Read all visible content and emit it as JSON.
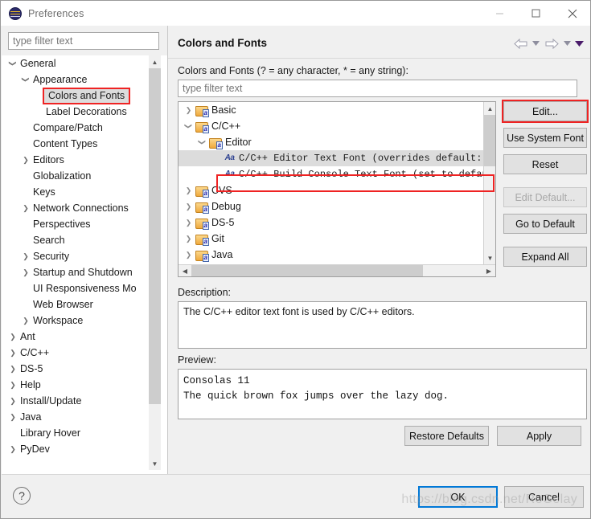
{
  "window": {
    "title": "Preferences",
    "icon": "eclipse-icon",
    "minimize_label": "—",
    "maximize_label": "□",
    "close_label": "✕"
  },
  "sidebar": {
    "filter_placeholder": "type filter text",
    "filter_value": "",
    "items": [
      {
        "label": "General",
        "depth": 0,
        "arrow": "expanded",
        "selected": false
      },
      {
        "label": "Appearance",
        "depth": 1,
        "arrow": "expanded",
        "selected": false
      },
      {
        "label": "Colors and Fonts",
        "depth": 2,
        "arrow": "none",
        "selected": true
      },
      {
        "label": "Label Decorations",
        "depth": 2,
        "arrow": "none",
        "selected": false
      },
      {
        "label": "Compare/Patch",
        "depth": 1,
        "arrow": "none",
        "selected": false
      },
      {
        "label": "Content Types",
        "depth": 1,
        "arrow": "none",
        "selected": false
      },
      {
        "label": "Editors",
        "depth": 1,
        "arrow": "collapsed",
        "selected": false
      },
      {
        "label": "Globalization",
        "depth": 1,
        "arrow": "none",
        "selected": false
      },
      {
        "label": "Keys",
        "depth": 1,
        "arrow": "none",
        "selected": false
      },
      {
        "label": "Network Connections",
        "depth": 1,
        "arrow": "collapsed",
        "selected": false
      },
      {
        "label": "Perspectives",
        "depth": 1,
        "arrow": "none",
        "selected": false
      },
      {
        "label": "Search",
        "depth": 1,
        "arrow": "none",
        "selected": false
      },
      {
        "label": "Security",
        "depth": 1,
        "arrow": "collapsed",
        "selected": false
      },
      {
        "label": "Startup and Shutdown",
        "depth": 1,
        "arrow": "collapsed",
        "selected": false
      },
      {
        "label": "UI Responsiveness Mo",
        "depth": 1,
        "arrow": "none",
        "selected": false
      },
      {
        "label": "Web Browser",
        "depth": 1,
        "arrow": "none",
        "selected": false
      },
      {
        "label": "Workspace",
        "depth": 1,
        "arrow": "collapsed",
        "selected": false
      },
      {
        "label": "Ant",
        "depth": 0,
        "arrow": "collapsed",
        "selected": false
      },
      {
        "label": "C/C++",
        "depth": 0,
        "arrow": "collapsed",
        "selected": false
      },
      {
        "label": "DS-5",
        "depth": 0,
        "arrow": "collapsed",
        "selected": false
      },
      {
        "label": "Help",
        "depth": 0,
        "arrow": "collapsed",
        "selected": false
      },
      {
        "label": "Install/Update",
        "depth": 0,
        "arrow": "collapsed",
        "selected": false
      },
      {
        "label": "Java",
        "depth": 0,
        "arrow": "collapsed",
        "selected": false
      },
      {
        "label": "Library Hover",
        "depth": 0,
        "arrow": "none",
        "selected": false
      },
      {
        "label": "PyDev",
        "depth": 0,
        "arrow": "collapsed",
        "selected": false
      }
    ]
  },
  "main": {
    "page_title": "Colors and Fonts",
    "filter_label": "Colors and Fonts (? = any character, * = any string):",
    "filter_placeholder": "type filter text",
    "filter_value": "",
    "nav": {
      "back_icon": "back-arrow-icon",
      "back_caret_icon": "chevron-down-icon",
      "forward_icon": "forward-arrow-icon",
      "forward_caret_icon": "chevron-down-icon",
      "menu_caret_icon": "chevron-down-filled-icon"
    },
    "tree": [
      {
        "label": "Basic",
        "depth": 0,
        "arrow": "collapsed",
        "icon": "folder-font-icon",
        "selected": false,
        "mono": false
      },
      {
        "label": "C/C++",
        "depth": 0,
        "arrow": "expanded",
        "icon": "folder-font-icon",
        "selected": false,
        "mono": false
      },
      {
        "label": "Editor",
        "depth": 1,
        "arrow": "expanded",
        "icon": "folder-font-icon",
        "selected": false,
        "mono": false
      },
      {
        "label": "C/C++ Editor Text Font (overrides default:",
        "depth": 2,
        "arrow": "none",
        "icon": "font-aa-icon",
        "selected": true,
        "mono": true
      },
      {
        "label": "C/C++ Build Console Text Font (set to default",
        "depth": 2,
        "arrow": "none",
        "icon": "font-aa-icon",
        "selected": false,
        "mono": true
      },
      {
        "label": "CVS",
        "depth": 0,
        "arrow": "collapsed",
        "icon": "folder-font-icon",
        "selected": false,
        "mono": false
      },
      {
        "label": "Debug",
        "depth": 0,
        "arrow": "collapsed",
        "icon": "folder-font-icon",
        "selected": false,
        "mono": false
      },
      {
        "label": "DS-5",
        "depth": 0,
        "arrow": "collapsed",
        "icon": "folder-font-icon",
        "selected": false,
        "mono": false
      },
      {
        "label": "Git",
        "depth": 0,
        "arrow": "collapsed",
        "icon": "folder-font-icon",
        "selected": false,
        "mono": false
      },
      {
        "label": "Java",
        "depth": 0,
        "arrow": "collapsed",
        "icon": "folder-font-icon",
        "selected": false,
        "mono": false
      }
    ],
    "side_buttons": [
      {
        "label": "Edit...",
        "disabled": false,
        "highlighted": true
      },
      {
        "label": "Use System Font",
        "disabled": false,
        "highlighted": false
      },
      {
        "label": "Reset",
        "disabled": false,
        "highlighted": false
      },
      {
        "label": "Edit Default...",
        "disabled": true,
        "highlighted": false
      },
      {
        "label": "Go to Default",
        "disabled": false,
        "highlighted": false
      },
      {
        "label": "Expand All",
        "disabled": false,
        "highlighted": false
      }
    ],
    "description_label": "Description:",
    "description_text": "The C/C++ editor text font is used by C/C++ editors.",
    "preview_label": "Preview:",
    "preview_line1": "Consolas 11",
    "preview_line2": "The quick brown fox jumps over the lazy dog.",
    "restore_defaults_label": "Restore Defaults",
    "apply_label": "Apply"
  },
  "footer": {
    "help_icon_label": "?",
    "ok_label": "OK",
    "cancel_label": "Cancel"
  },
  "watermark": "https://blog.csdn.net/ReGelay",
  "colors": {
    "accent": "#0078d7",
    "highlight_box": "#ef2323",
    "selection_bg": "#dcdcdc",
    "chrome_bg": "#f0f0f0"
  }
}
